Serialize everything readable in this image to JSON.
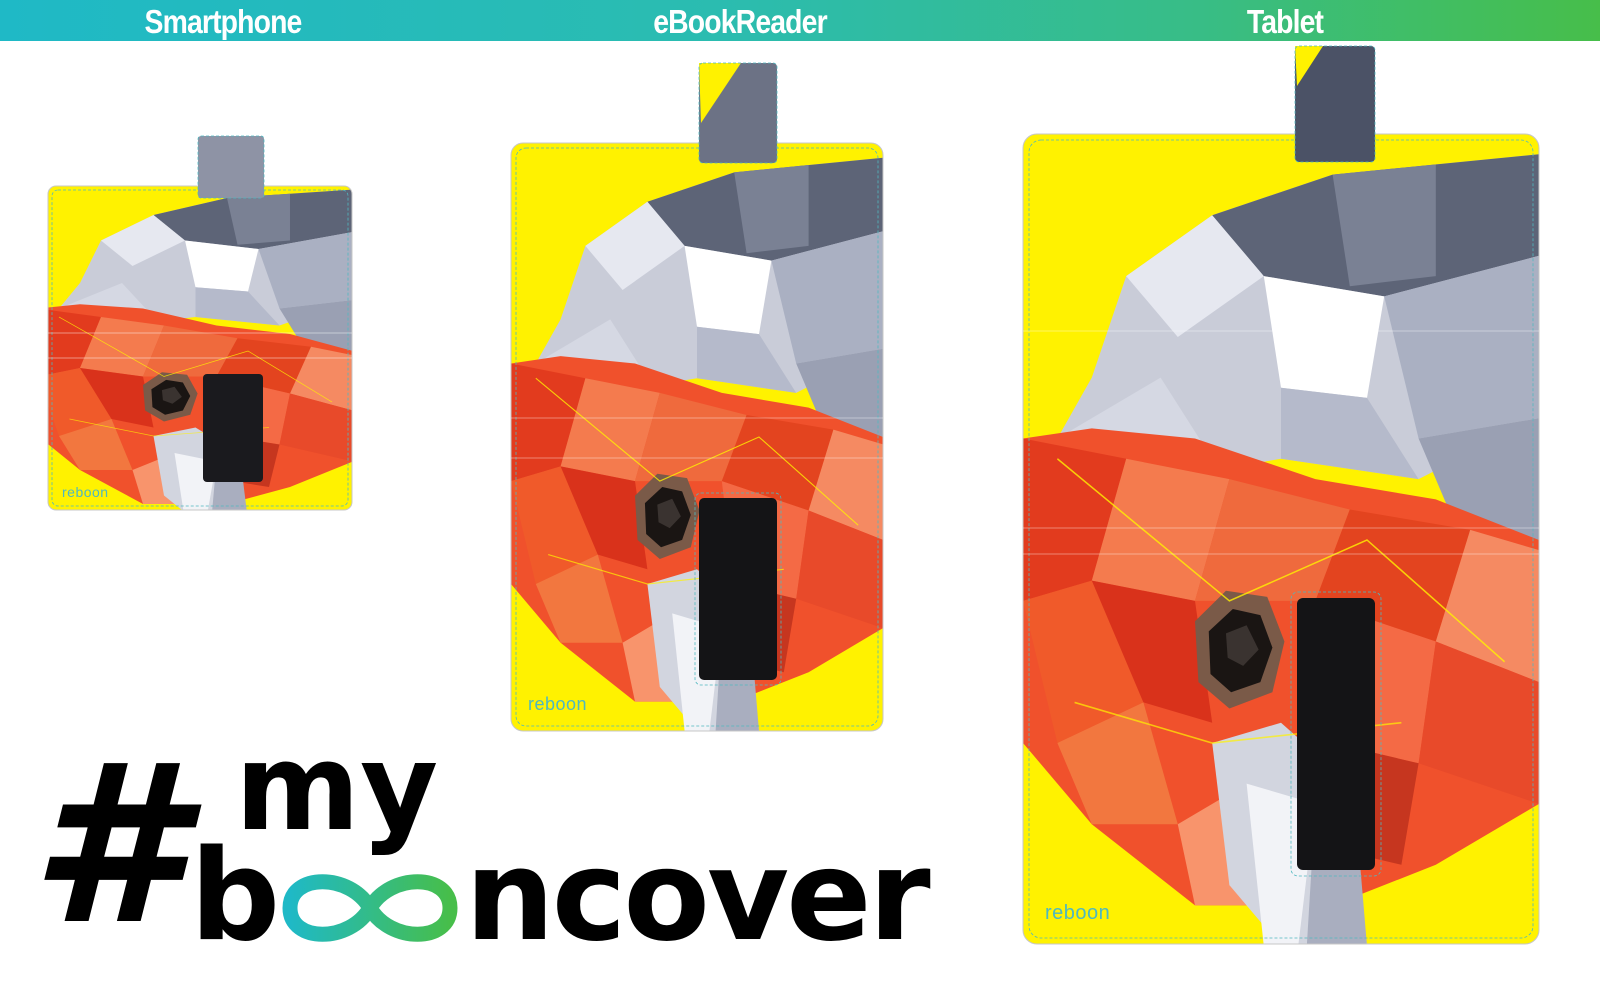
{
  "header": {
    "smartphone_label": "Smartphone",
    "ebookreader_label": "eBookReader",
    "tablet_label": "Tablet"
  },
  "covers": {
    "brand_wordmark": "reboon"
  },
  "hashtag": {
    "hash": "#",
    "my": "my",
    "word_start": "b",
    "word_end": "ncover"
  },
  "colors": {
    "header_gradient_start": "#1fb9c6",
    "header_gradient_end": "#47be4a",
    "cover_background": "#fff200",
    "infinity_start": "#1fb9c6",
    "infinity_end": "#47be4a"
  }
}
